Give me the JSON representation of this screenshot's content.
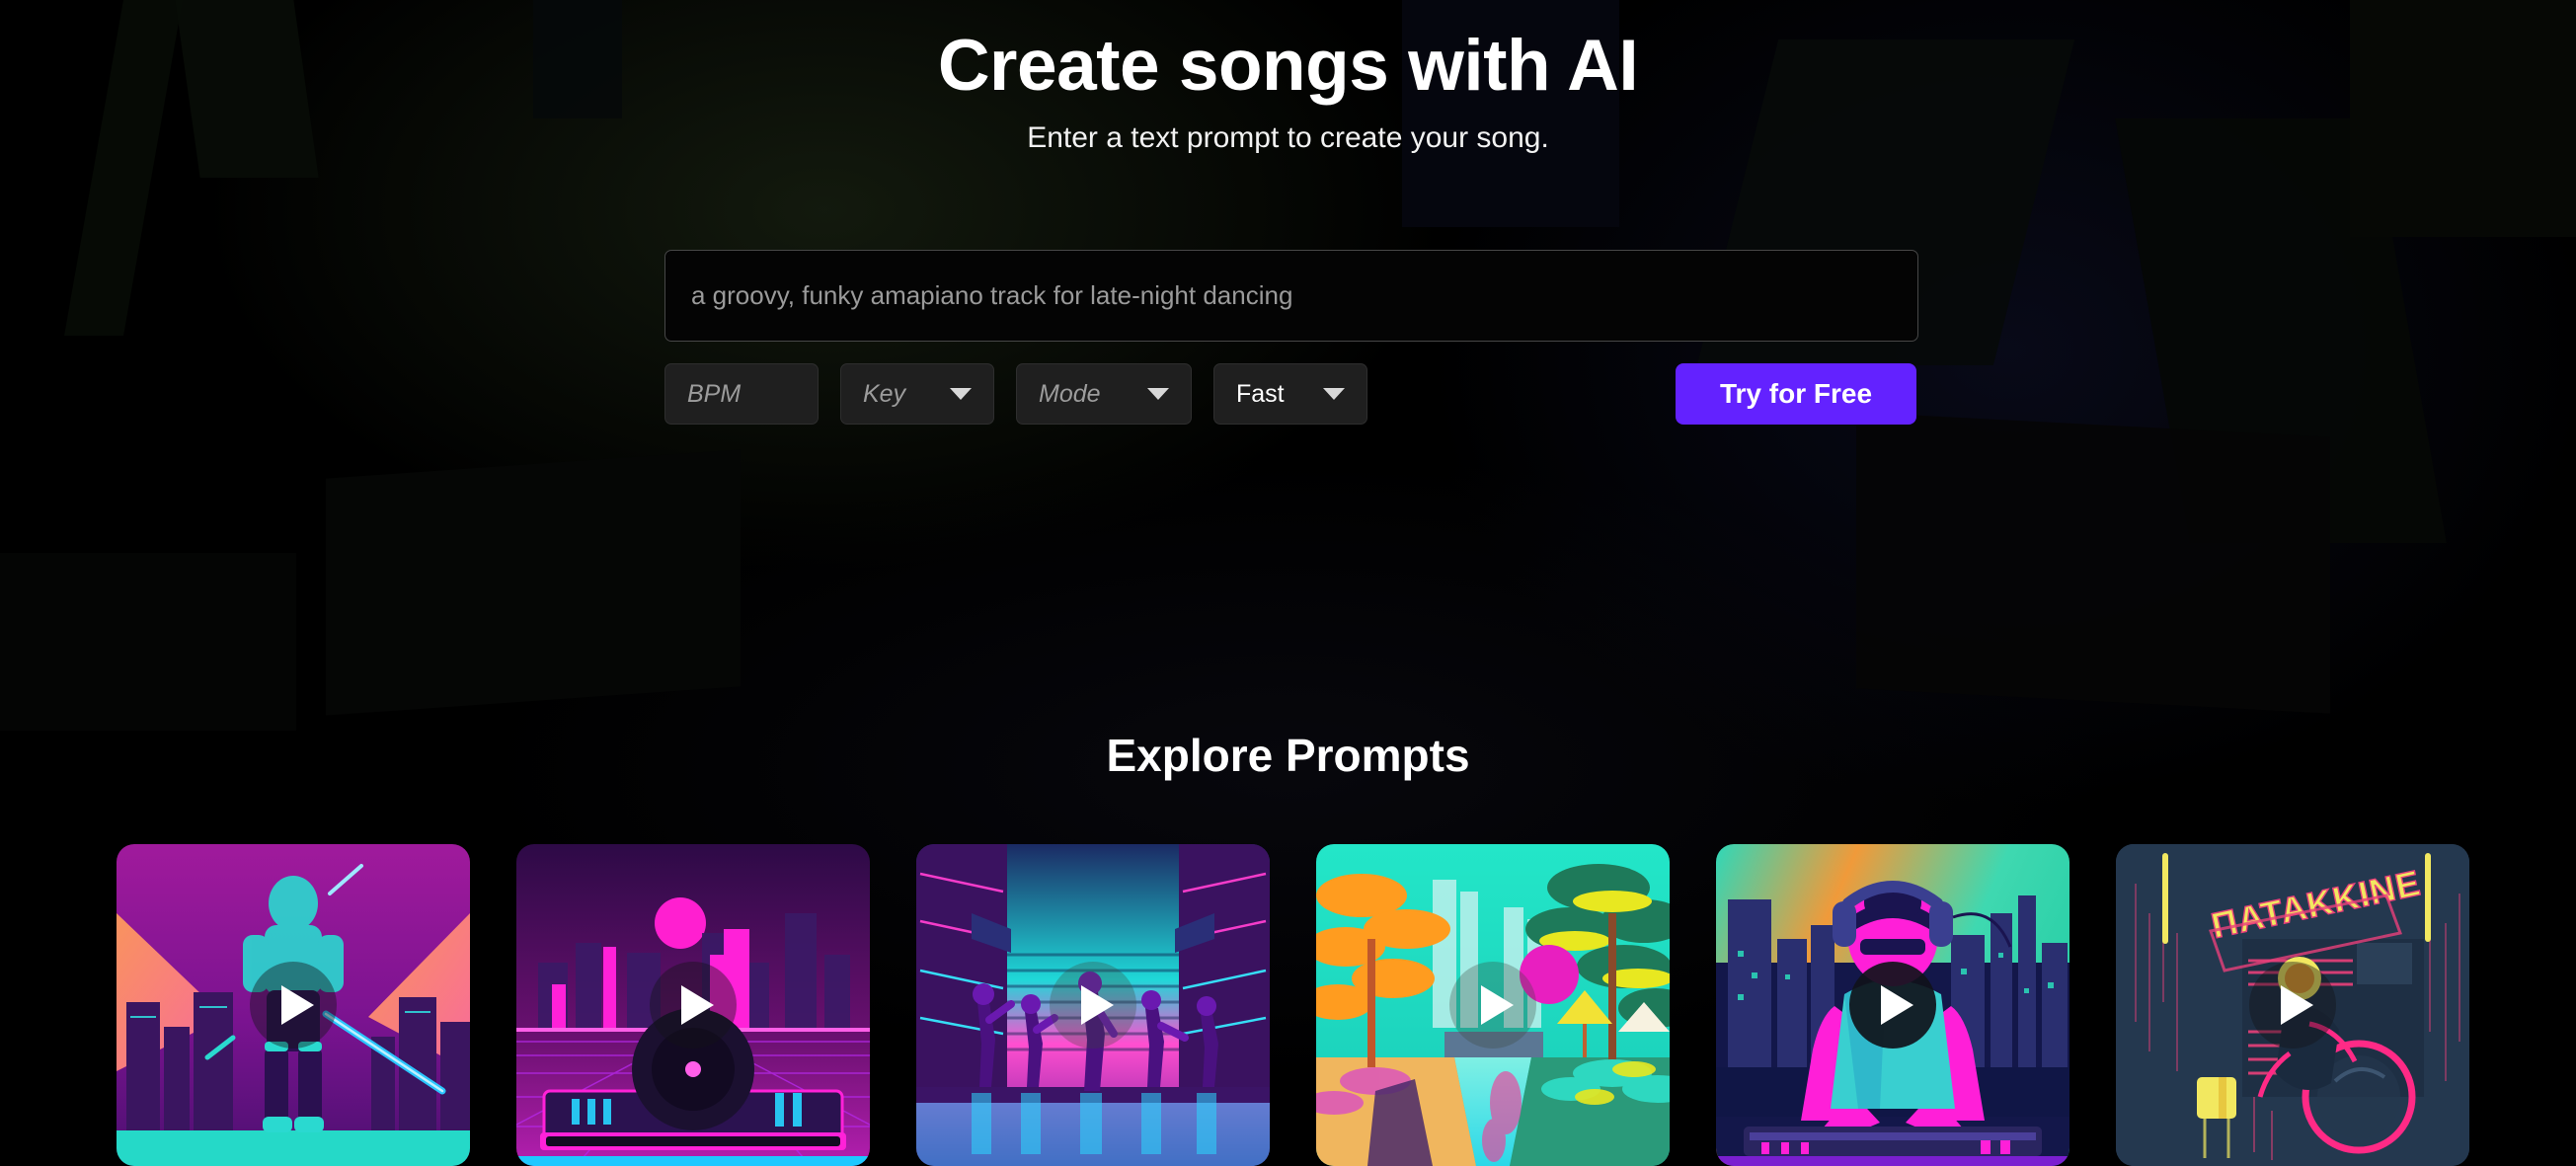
{
  "hero": {
    "title": "Create songs with AI",
    "subtitle": "Enter a text prompt to create your song."
  },
  "form": {
    "prompt_value": "",
    "prompt_placeholder": "a groovy, funky amapiano track for late-night dancing",
    "bpm_placeholder": "BPM",
    "key_label": "Key",
    "mode_label": "Mode",
    "speed_label": "Fast",
    "cta_label": "Try for Free",
    "cta_color": "#6322ff"
  },
  "explore": {
    "title": "Explore Prompts",
    "cards": [
      {
        "name": "neon-cyber-samurai",
        "icon": "play-icon"
      },
      {
        "name": "synthwave-turntable",
        "icon": "play-icon"
      },
      {
        "name": "neon-street-dancers",
        "icon": "play-icon"
      },
      {
        "name": "tropical-neon-canal",
        "icon": "play-icon"
      },
      {
        "name": "dj-with-headphones",
        "icon": "play-icon"
      },
      {
        "name": "neon-sign-rider",
        "icon": "play-icon",
        "sign_text": "ΠΑΤΑΚΚΙΝΕ"
      }
    ]
  }
}
